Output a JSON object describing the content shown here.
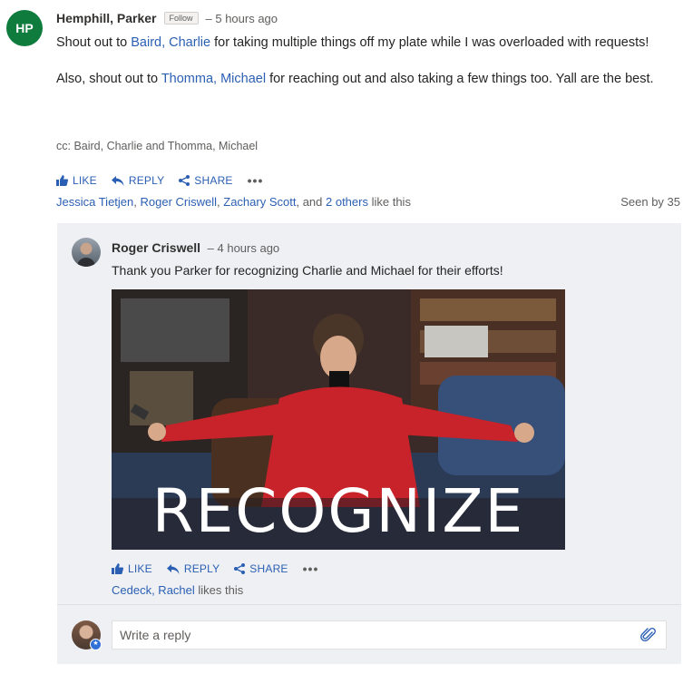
{
  "post": {
    "avatar_initials": "HP",
    "avatar_color": "#0f7b3d",
    "author": "Hemphill, Parker",
    "follow_label": "Follow",
    "time": "– 5 hours ago",
    "p1_before": "Shout out to ",
    "p1_mention": "Baird, Charlie",
    "p1_after": " for taking multiple things off my plate while I was overloaded with requests!",
    "p2_before": "Also, shout out to ",
    "p2_mention": "Thomma, Michael",
    "p2_after": " for reaching out and also taking a few things too.  Yall are the best.",
    "cc": "cc: Baird, Charlie and Thomma, Michael",
    "actions": {
      "like": "LIKE",
      "reply": "REPLY",
      "share": "SHARE",
      "more": "•••"
    },
    "likes": {
      "liker1": "Jessica Tietjen",
      "liker2": "Roger Criswell",
      "liker3": "Zachary Scott",
      "and_text": ", and ",
      "others": "2 others",
      "suffix": " like this"
    },
    "seen_by": "Seen by 35"
  },
  "reply": {
    "author": "Roger Criswell",
    "time": "– 4 hours ago",
    "text": "Thank you Parker for recognizing Charlie and Michael for their efforts!",
    "gif_caption": "RECOGNIZE",
    "actions": {
      "like": "LIKE",
      "reply": "REPLY",
      "share": "SHARE",
      "more": "•••"
    },
    "liked_by": "Cedeck, Rachel",
    "liked_suffix": " likes this"
  },
  "compose": {
    "placeholder": "Write a reply",
    "badge": "★"
  },
  "colors": {
    "link": "#2b5fb3",
    "thread_bg": "#eef0f4",
    "muted": "#605e5c"
  }
}
